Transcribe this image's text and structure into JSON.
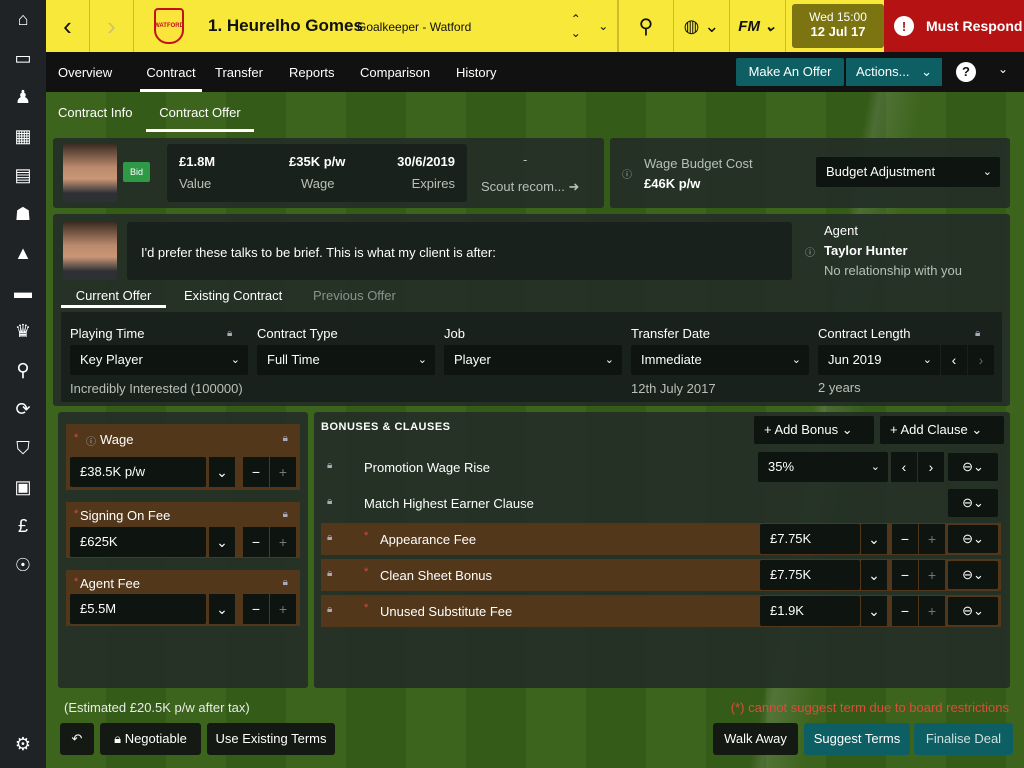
{
  "topbar": {
    "club_badge_text": "WATFORD",
    "player_name": "1. Heurelho Gomes",
    "player_role": "Goalkeeper - Watford",
    "date_line1": "Wed 15:00",
    "date_line2": "12 Jul 17",
    "must_respond": "Must Respond",
    "must_respond_symbol": "!",
    "fm_label": "FM"
  },
  "tabs": [
    "Overview",
    "Contract",
    "Transfer",
    "Reports",
    "Comparison",
    "History"
  ],
  "make_offer": "Make An Offer",
  "actions": "Actions...",
  "help": "?",
  "subtabs": [
    "Contract Info",
    "Contract Offer"
  ],
  "summary": {
    "bid_badge": "Bid",
    "value": "£1.8M",
    "value_label": "Value",
    "wage": "£35K p/w",
    "wage_label": "Wage",
    "expires": "30/6/2019",
    "expires_label": "Expires",
    "scout_dash": "-",
    "scout": "Scout recom...",
    "budget_label": "Wage Budget Cost",
    "budget_value": "£46K p/w",
    "budget_adjust": "Budget Adjustment"
  },
  "agent": {
    "message": "I'd prefer these talks to be brief. This is what my client is after:",
    "title": "Agent",
    "name": "Taylor Hunter",
    "relation": "No relationship with you"
  },
  "offer_tabs": [
    "Current Offer",
    "Existing Contract",
    "Previous Offer"
  ],
  "terms": {
    "playing_time_label": "Playing Time",
    "playing_time": "Key Player",
    "interest": "Incredibly Interested (100000)",
    "contract_type_label": "Contract Type",
    "contract_type": "Full Time",
    "job_label": "Job",
    "job": "Player",
    "transfer_date_label": "Transfer Date",
    "transfer_date": "Immediate",
    "transfer_date_note": "12th July 2017",
    "contract_length_label": "Contract Length",
    "contract_length": "Jun 2019",
    "contract_length_note": "2 years"
  },
  "fees": [
    {
      "label": "Wage",
      "value": "£38.5K p/w"
    },
    {
      "label": "Signing On Fee",
      "value": "£625K"
    },
    {
      "label": "Agent Fee",
      "value": "£5.5M"
    }
  ],
  "bonuses": {
    "header": "BONUSES & CLAUSES",
    "add_bonus": "Add Bonus",
    "add_clause": "Add Clause",
    "rows": [
      {
        "label": "Promotion Wage Rise",
        "value": "35%"
      },
      {
        "label": "Match Highest Earner Clause",
        "value": ""
      },
      {
        "label": "Appearance Fee",
        "value": "£7.75K"
      },
      {
        "label": "Clean Sheet Bonus",
        "value": "£7.75K"
      },
      {
        "label": "Unused Substitute Fee",
        "value": "£1.9K"
      }
    ]
  },
  "footer": {
    "tax_note": "(Estimated £20.5K p/w after tax)",
    "restriction": "(*) cannot suggest term due to board restrictions",
    "negotiable": "Negotiable",
    "use_existing": "Use Existing Terms",
    "walk_away": "Walk Away",
    "suggest": "Suggest Terms",
    "finalise": "Finalise Deal"
  },
  "colors": {
    "topbar": "#f7e83a",
    "must_respond": "#b51313",
    "accent_teal": "#0d5f63",
    "restriction_text": "#e04a3a"
  }
}
